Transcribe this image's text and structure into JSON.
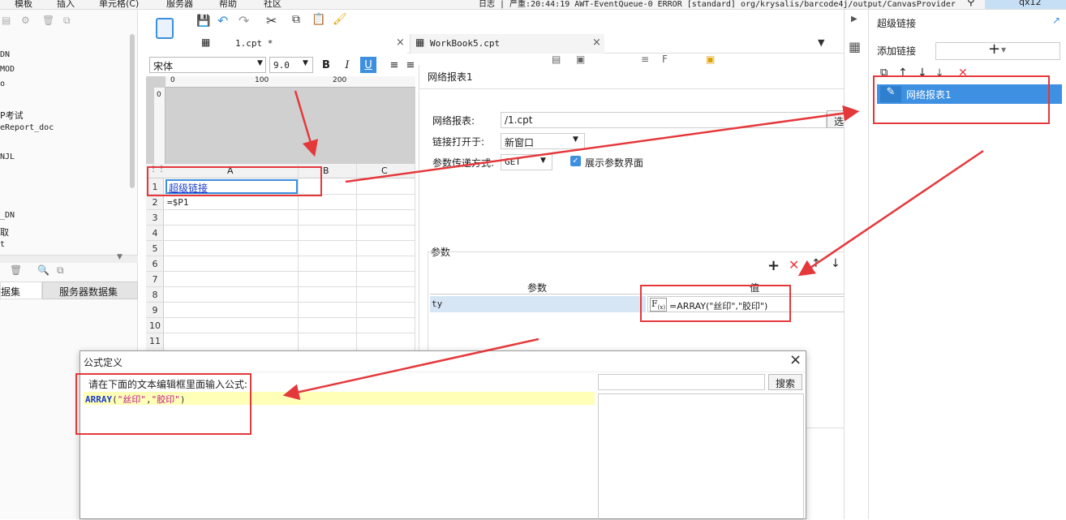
{
  "menubar": {
    "items": [
      "模板",
      "插入",
      "单元格(C)",
      "服务器",
      "帮助",
      "社区"
    ],
    "log_text": "日志 | 严重:20:44:19 AWT-EventQueue-0 ERROR [standard] org/krysalis/barcode4j/output/CanvasProvider",
    "user": "qx12"
  },
  "left_panel": {
    "tree_items": [
      "DN",
      "MOD",
      "o",
      "",
      "P考试",
      "eReport_doc",
      "",
      "NJL",
      "",
      "",
      "",
      "_DN",
      "取",
      "t"
    ],
    "tab_left": "据集",
    "tab_right": "服务器数据集"
  },
  "editor": {
    "tabs": [
      {
        "label": "1.cpt *"
      },
      {
        "label": "WorkBook5.cpt"
      }
    ],
    "font_name": "宋体",
    "font_size": "9.0",
    "ruler_marks": [
      "0",
      "100",
      "200"
    ],
    "ruler_v_mark": "0",
    "columns": [
      "A",
      "B",
      "C"
    ],
    "rows": [
      "1",
      "2",
      "3",
      "4",
      "5",
      "6",
      "7",
      "8",
      "9",
      "10",
      "11"
    ],
    "cell_a1": "超级链接",
    "cell_a2": "=$P1"
  },
  "hyperlink_form": {
    "title": "网络报表1",
    "report_label": "网络报表:",
    "report_value": "/1.cpt",
    "select_button": "选择",
    "open_in_label": "链接打开于:",
    "open_in_value": "新窗口",
    "param_method_label": "参数传递方式:",
    "param_method_value": "GET",
    "show_param_label": "展示参数界面",
    "show_param_checked": true,
    "params_section": "参数",
    "col_param": "参数",
    "col_value": "值",
    "param_row_name": "ty",
    "param_row_value": "=ARRAY(\"丝印\",\"胶印\")"
  },
  "right_panel": {
    "title": "超级链接",
    "add_link_label": "添加链接",
    "add_symbol": "+",
    "list_item": "网络报表1"
  },
  "formula_dialog": {
    "title": "公式定义",
    "prompt": "请在下面的文本编辑框里面输入公式:",
    "formula_fn": "ARRAY",
    "formula_open": "(",
    "formula_arg1": "\"丝印\"",
    "formula_comma": ",",
    "formula_arg2": "\"胶印\"",
    "formula_close": ")",
    "search_button": "搜索",
    "close_symbol": "×"
  },
  "colors": {
    "accent_blue": "#3d8fe0",
    "annotation_red": "#e5383b",
    "selected_item": "#3e90e2"
  }
}
